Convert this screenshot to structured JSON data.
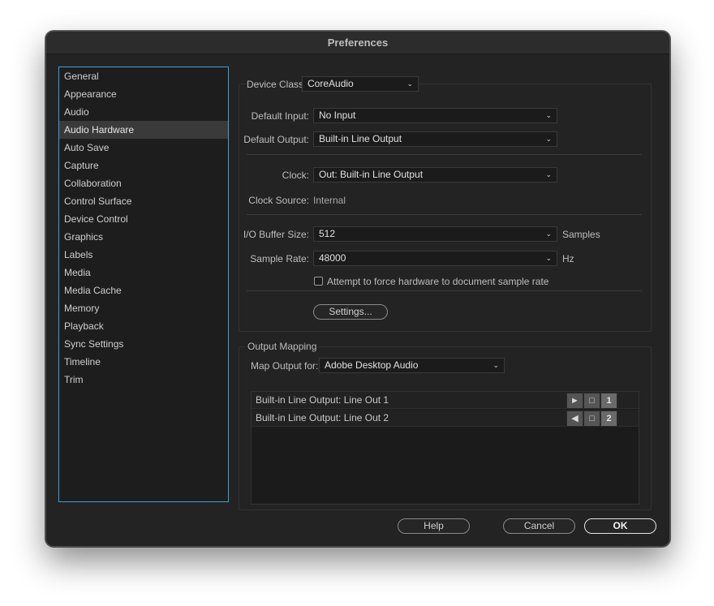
{
  "window": {
    "title": "Preferences"
  },
  "sidebar": {
    "items": [
      {
        "label": "General"
      },
      {
        "label": "Appearance"
      },
      {
        "label": "Audio"
      },
      {
        "label": "Audio Hardware",
        "selected": true
      },
      {
        "label": "Auto Save"
      },
      {
        "label": "Capture"
      },
      {
        "label": "Collaboration"
      },
      {
        "label": "Control Surface"
      },
      {
        "label": "Device Control"
      },
      {
        "label": "Graphics"
      },
      {
        "label": "Labels"
      },
      {
        "label": "Media"
      },
      {
        "label": "Media Cache"
      },
      {
        "label": "Memory"
      },
      {
        "label": "Playback"
      },
      {
        "label": "Sync Settings"
      },
      {
        "label": "Timeline"
      },
      {
        "label": "Trim"
      }
    ]
  },
  "device": {
    "class_label": "Device Class:",
    "class_value": "CoreAudio",
    "default_input_label": "Default Input:",
    "default_input_value": "No Input",
    "default_output_label": "Default Output:",
    "default_output_value": "Built-in Line Output",
    "clock_label": "Clock:",
    "clock_value": "Out: Built-in Line Output",
    "clock_source_label": "Clock Source:",
    "clock_source_value": "Internal",
    "buffer_label": "I/O Buffer Size:",
    "buffer_value": "512",
    "buffer_unit": "Samples",
    "rate_label": "Sample Rate:",
    "rate_value": "48000",
    "rate_unit": "Hz",
    "force_rate_label": "Attempt to force hardware to document sample rate",
    "force_rate_checked": false,
    "settings_button": "Settings..."
  },
  "output_mapping": {
    "title": "Output Mapping",
    "map_for_label": "Map Output for:",
    "map_for_value": "Adobe Desktop Audio",
    "rows": [
      {
        "label": "Built-in Line Output: Line Out 1",
        "channel": "1",
        "icon": "speaker-left-icon"
      },
      {
        "label": "Built-in Line Output: Line Out 2",
        "channel": "2",
        "icon": "speaker-right-icon"
      }
    ]
  },
  "footer": {
    "help": "Help",
    "cancel": "Cancel",
    "ok": "OK"
  },
  "colors": {
    "accent": "#3aa0d8",
    "background": "#232323"
  }
}
